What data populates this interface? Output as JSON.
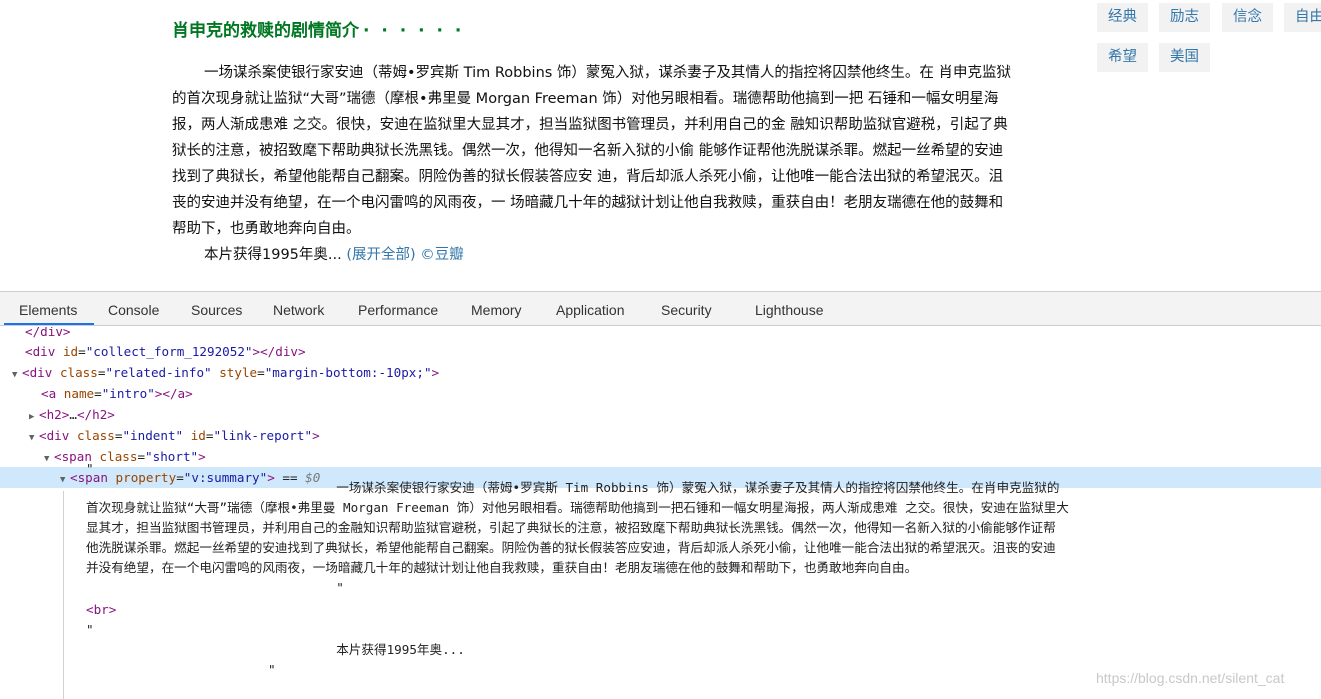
{
  "page": {
    "intro_title": "肖申克的救赎的剧情简介",
    "intro_dots": "· · · · · ·",
    "intro_lines": [
      "一场谋杀案使银行家安迪（蒂姆•罗宾斯 Tim Robbins 饰）蒙冤入狱，谋杀妻子及其情人的指控将囚禁他终生。在",
      "肖申克监狱的首次现身就让监狱“大哥”瑞德（摩根•弗里曼 Morgan Freeman 饰）对他另眼相看。瑞德帮助他搞到一把",
      "石锤和一幅女明星海报，两人渐成患难 之交。很快，安迪在监狱里大显其才，担当监狱图书管理员，并利用自己的金",
      "融知识帮助监狱官避税，引起了典狱长的注意，被招致麾下帮助典狱长洗黑钱。偶然一次，他得知一名新入狱的小偷",
      "能够作证帮他洗脱谋杀罪。燃起一丝希望的安迪找到了典狱长，希望他能帮自己翻案。阴险伪善的狱长假装答应安",
      "迪，背后却派人杀死小偷，让他唯一能合法出狱的希望泯灭。沮丧的安迪并没有绝望，在一个电闪雷鸣的风雨夜，一",
      "场暗藏几十年的越狱计划让他自我救赎，重获自由！老朋友瑞德在他的鼓舞和帮助下，也勇敢地奔向自由。"
    ],
    "intro_last": "本片获得1995年奥...",
    "expand_link": "(展开全部)",
    "copyright": "©豆瓣",
    "tags": [
      "经典",
      "励志",
      "信念",
      "自由",
      "希望",
      "美国"
    ]
  },
  "devtools": {
    "tabs": [
      "Elements",
      "Console",
      "Sources",
      "Network",
      "Performance",
      "Memory",
      "Application",
      "Security",
      "Lighthouse"
    ],
    "active_tab": "Elements",
    "tree": {
      "r0": "</div>",
      "r1_tag": "div",
      "r1_attr": "id",
      "r1_val": "\"collect_form_1292052\"",
      "r2_tag": "div",
      "r2_attr1": "class",
      "r2_val1": "\"related-info\"",
      "r2_attr2": "style",
      "r2_val2": "\"margin-bottom:-10px;\"",
      "r3_tag": "a",
      "r3_attr": "name",
      "r3_val": "\"intro\"",
      "r4_tag": "h2",
      "r5_tag": "div",
      "r5_attr1": "class",
      "r5_val1": "\"indent\"",
      "r5_attr2": "id",
      "r5_val2": "\"link-report\"",
      "r6_tag": "span",
      "r6_attr": "class",
      "r6_val": "\"short\"",
      "r7_tag": "span",
      "r7_attr": "property",
      "r7_val": "\"v:summary\"",
      "r7_marker": "$0",
      "text_lines": [
        "\"",
        "                                 一场谋杀案使银行家安迪（蒂姆•罗宾斯 Tim Robbins 饰）蒙冤入狱，谋杀妻子及其情人的指控将囚禁他终生。在肖申克监狱的",
        "首次现身就让监狱“大哥”瑞德（摩根•弗里曼 Morgan Freeman 饰）对他另眼相看。瑞德帮助他搞到一把石锤和一幅女明星海报，两人渐成患难 之交。很快，安迪在监狱里大",
        "显其才，担当监狱图书管理员，并利用自己的金融知识帮助监狱官避税，引起了典狱长的注意，被招致麾下帮助典狱长洗黑钱。偶然一次，他得知一名新入狱的小偷能够作证帮",
        "他洗脱谋杀罪。燃起一丝希望的安迪找到了典狱长，希望他能帮自己翻案。阴险伪善的狱长假装答应安迪，背后却派人杀死小偷，让他唯一能合法出狱的希望泯灭。沮丧的安迪",
        "并没有绝望，在一个电闪雷鸣的风雨夜，一场暗藏几十年的越狱计划让他自我救赎，重获自由！老朋友瑞德在他的鼓舞和帮助下，也勇敢地奔向自由。",
        "                                 \"",
        "<br>",
        "\"",
        "                                 本片获得1995年奥...",
        "                        \""
      ]
    },
    "watermark": "https://blog.csdn.net/silent_cat"
  },
  "colors": {
    "tag_name": "#881280",
    "attr_name": "#994500",
    "attr_value": "#1a1aa6",
    "selected_row": "#cfe8fc",
    "title_green": "#007722",
    "link_blue": "#3377aa"
  }
}
